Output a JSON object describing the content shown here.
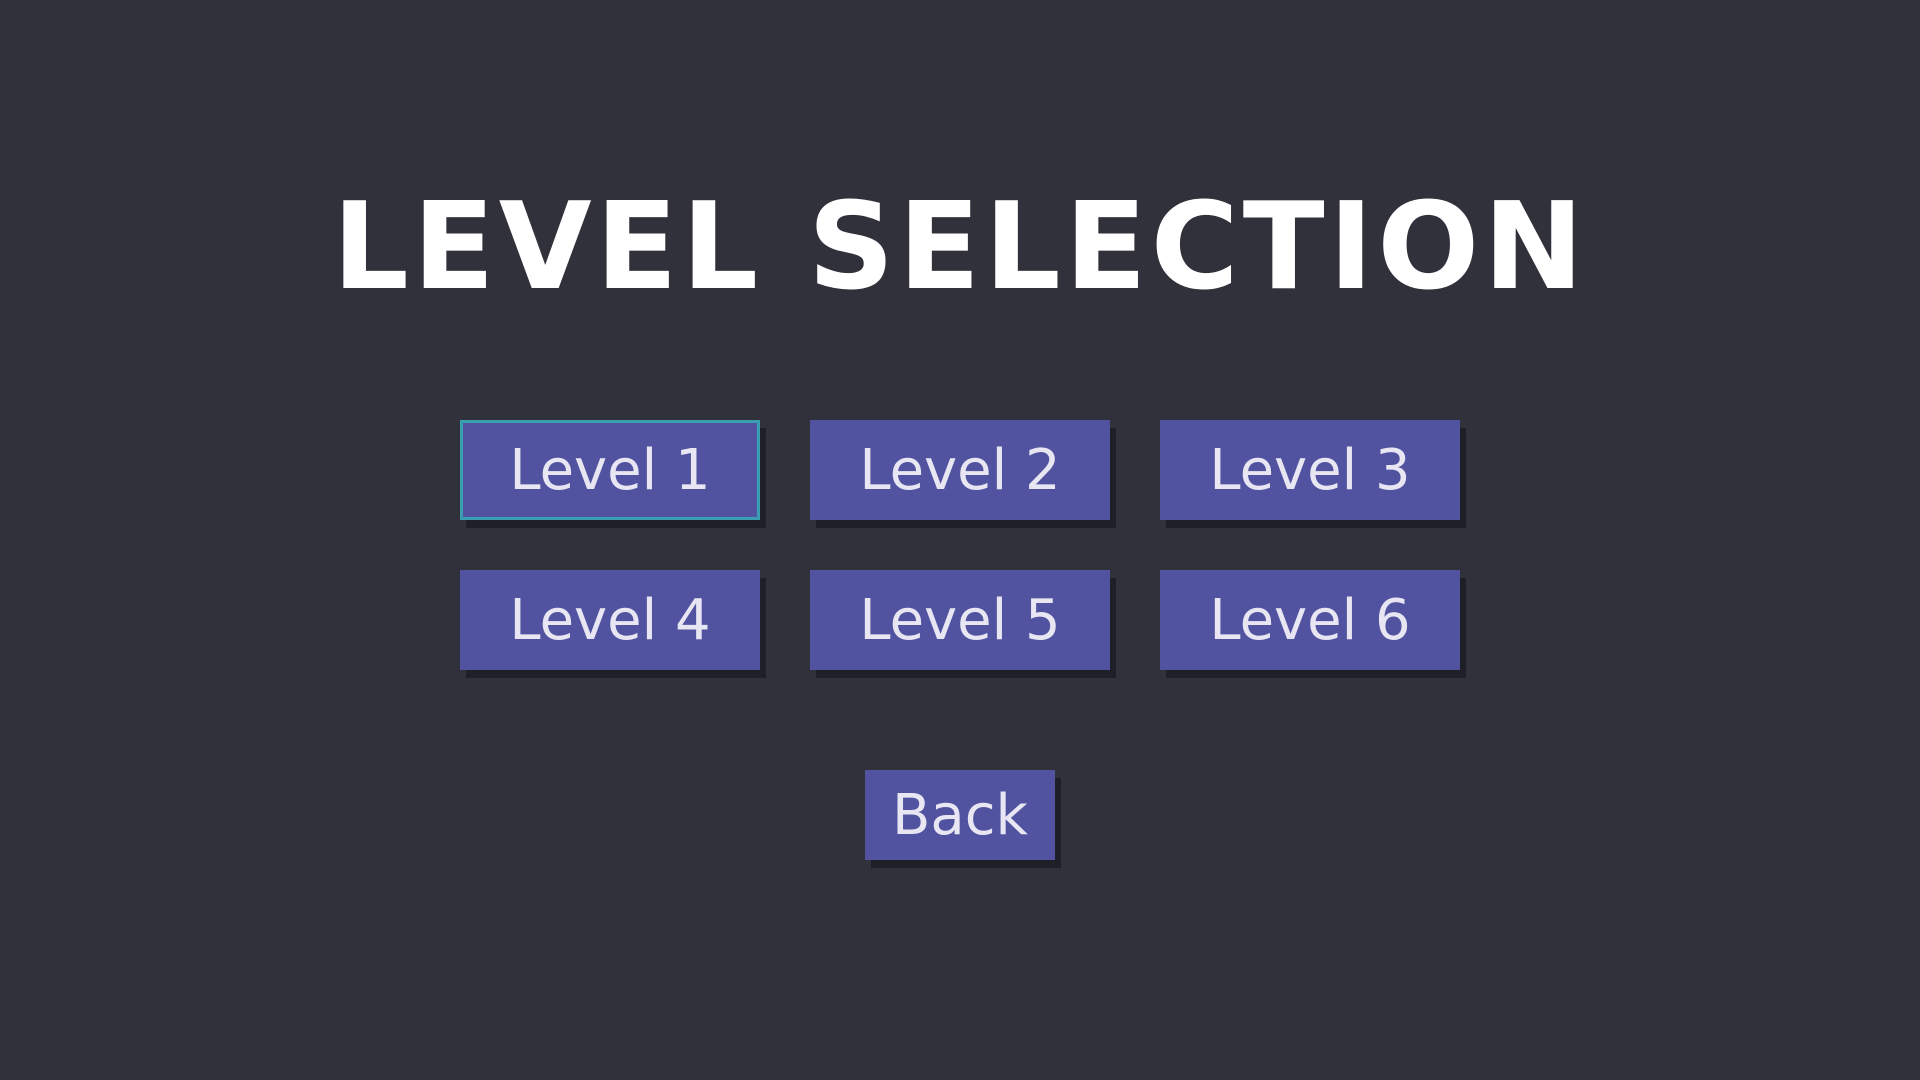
{
  "screen": {
    "title": "LEVEL SELECTION",
    "selected_level_index": 0
  },
  "levels": [
    {
      "label": "Level 1",
      "selected": true
    },
    {
      "label": "Level 2",
      "selected": false
    },
    {
      "label": "Level 3",
      "selected": false
    },
    {
      "label": "Level 4",
      "selected": false
    },
    {
      "label": "Level 5",
      "selected": false
    },
    {
      "label": "Level 6",
      "selected": false
    }
  ],
  "back": {
    "label": "Back"
  },
  "colors": {
    "background": "#31313b",
    "button": "#5152a0",
    "button_text": "#e8e6f2",
    "selected_border": "#3a9fb0",
    "title": "#ffffff"
  }
}
